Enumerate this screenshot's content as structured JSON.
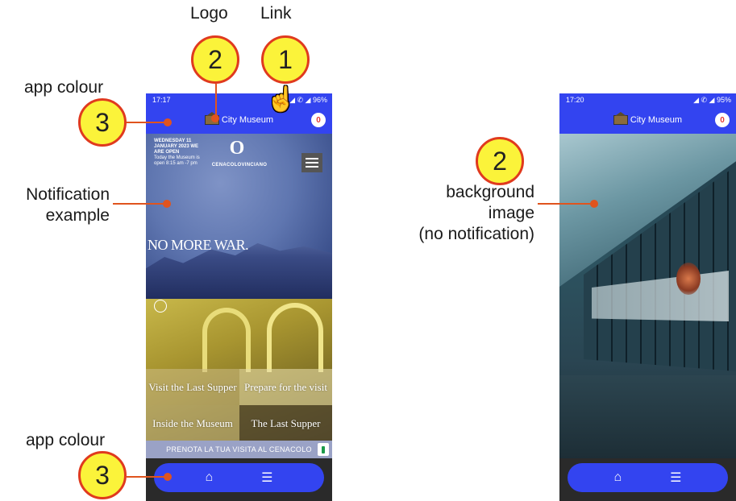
{
  "annotations": {
    "logo_label": "Logo",
    "link_label": "Link",
    "app_colour_top": "app colour",
    "app_colour_bottom": "app colour",
    "notification_example": [
      "Notification",
      "example"
    ],
    "background_image": [
      "background",
      "image",
      "(no notification)"
    ],
    "circle_1": "1",
    "circle_2_logo": "2",
    "circle_2_bg": "2",
    "circle_3_top": "3",
    "circle_3_bottom": "3"
  },
  "colors": {
    "app_colour": "#3344f0",
    "annotation_circle": "#fbf33a",
    "annotation_border": "#e03a1e",
    "annotation_line": "#e0541e"
  },
  "phone_left": {
    "status_time": "17:17",
    "status_icons": "◢ ✆ ◢ 96%",
    "app_title": "City Museum",
    "notification_count": "0",
    "notification": {
      "headline": "WEDNESDAY 11 JANUARY 2023 WE ARE OPEN",
      "body": "Today the Museum is open 8:15 am -7 pm"
    },
    "brand_mark": "O",
    "brand_name": "CENACOLOVINCIANO",
    "banner_text": "NO MORE WAR.",
    "tiles": {
      "visit": "Visit the Last Supper",
      "prepare": "Prepare for the visit",
      "inside": "Inside the Museum",
      "last_supper": "The Last Supper"
    },
    "prenota": "PRENOTA LA TUA VISITA AL CENACOLO",
    "nav": {
      "home_icon": "home-icon",
      "list_icon": "list-icon"
    }
  },
  "phone_right": {
    "status_time": "17:20",
    "status_icons": "◢ ✆ ◢ 95%",
    "app_title": "City Museum",
    "notification_count": "0",
    "nav": {
      "home_icon": "home-icon",
      "list_icon": "list-icon"
    }
  }
}
